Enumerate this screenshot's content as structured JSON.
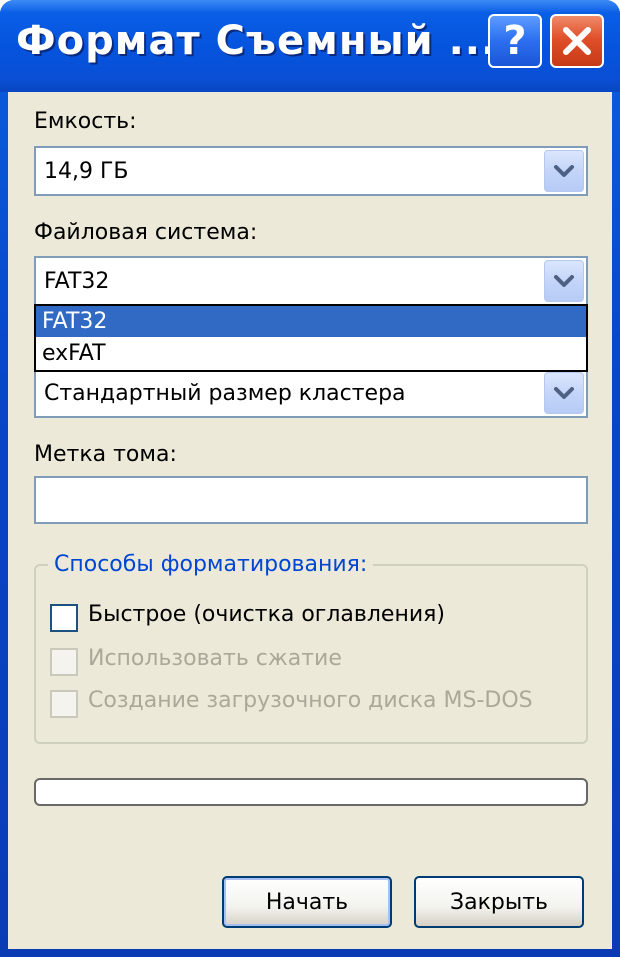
{
  "window": {
    "title": "Формат Съемный ...",
    "help_glyph": "?"
  },
  "capacity": {
    "label": "Емкость:",
    "value": "14,9 ГБ"
  },
  "file_system": {
    "label": "Файловая система:",
    "value": "FAT32",
    "options": [
      "FAT32",
      "exFAT"
    ],
    "highlighted": "FAT32"
  },
  "cluster_size": {
    "value": "Стандартный размер кластера"
  },
  "volume_label": {
    "label": "Метка тома:",
    "value": ""
  },
  "format_options": {
    "legend": "Способы форматирования:",
    "quick": {
      "label": "Быстрое (очистка оглавления)",
      "checked": false,
      "enabled": true
    },
    "compression": {
      "label": "Использовать сжатие",
      "checked": false,
      "enabled": false
    },
    "msdos": {
      "label": "Создание загрузочного диска MS-DOS",
      "checked": false,
      "enabled": false
    }
  },
  "progress": {
    "value": 0
  },
  "buttons": {
    "start": "Начать",
    "close": "Закрыть"
  },
  "colors": {
    "titlebar": "#0553dc",
    "client_bg": "#ece9d8",
    "selection": "#316ac5",
    "group_legend": "#0046d5",
    "disabled_text": "#aca899"
  },
  "icons": {
    "help": "question-mark-icon",
    "close": "close-x-icon",
    "combo_arrow": "chevron-down-icon"
  }
}
